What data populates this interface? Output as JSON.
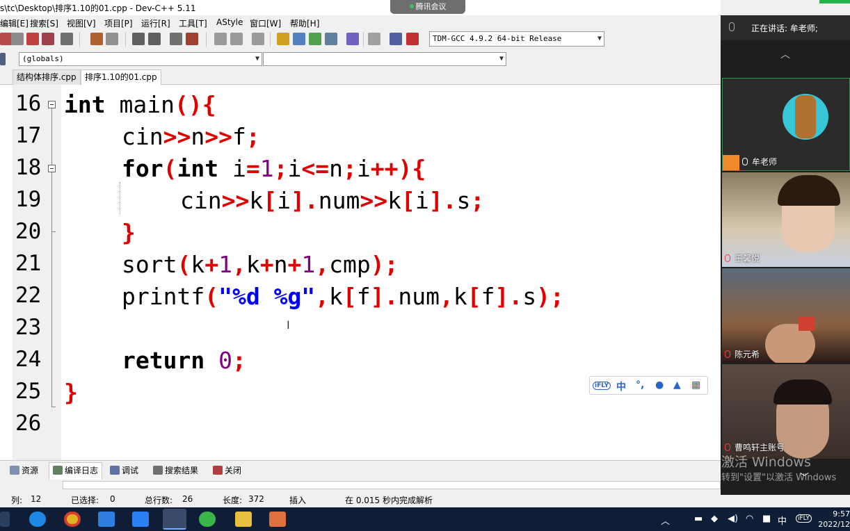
{
  "window": {
    "title": "s\\tc\\Desktop\\排序1.10的01.cpp - Dev-C++ 5.11",
    "meeting_pill": "腾讯会议"
  },
  "menu": [
    "编辑[E]",
    "搜索[S]",
    "视图[V]",
    "项目[P]",
    "运行[R]",
    "工具[T]",
    "AStyle",
    "窗口[W]",
    "帮助[H]"
  ],
  "toolbar": {
    "compiler": "TDM-GCC 4.9.2 64-bit Release"
  },
  "globals": {
    "scope": "(globals)",
    "symbol": ""
  },
  "tabs": [
    {
      "label": "结构体排序.cpp",
      "active": false
    },
    {
      "label": "排序1.10的01.cpp",
      "active": true
    }
  ],
  "editor": {
    "line_numbers": [
      "16",
      "17",
      "18",
      "19",
      "20",
      "21",
      "22",
      "23",
      "24",
      "25",
      "26"
    ],
    "code": {
      "l16a": "int",
      "l16b": " main",
      "l16c": "(){",
      "l17a": "cin",
      "l17b": ">>",
      "l17c": "n",
      "l17d": ">>",
      "l17e": "f",
      "l17f": ";",
      "l18a": "for",
      "l18b": "(",
      "l18c": "int",
      "l18d": " i",
      "l18e": "=",
      "l18f": "1",
      "l18g": ";",
      "l18h": "i",
      "l18i": "<=",
      "l18j": "n",
      "l18k": ";",
      "l18l": "i",
      "l18m": "++){",
      "l19a": "cin",
      "l19b": ">>",
      "l19c": "k",
      "l19d": "[",
      "l19e": "i",
      "l19f": "].",
      "l19g": "num",
      "l19h": ">>",
      "l19i": "k",
      "l19j": "[",
      "l19k": "i",
      "l19l": "].",
      "l19m": "s",
      "l19n": ";",
      "l20a": "}",
      "l21a": "sort",
      "l21b": "(",
      "l21c": "k",
      "l21d": "+",
      "l21e": "1",
      "l21f": ",",
      "l21g": "k",
      "l21h": "+",
      "l21i": "n",
      "l21j": "+",
      "l21k": "1",
      "l21l": ",",
      "l21m": "cmp",
      "l21n": ");",
      "l22a": "printf",
      "l22b": "(",
      "l22c": "\"%d %g\"",
      "l22d": ",",
      "l22e": "k",
      "l22f": "[",
      "l22g": "f",
      "l22h": "].",
      "l22i": "num",
      "l22j": ",",
      "l22k": "k",
      "l22l": "[",
      "l22m": "f",
      "l22n": "].",
      "l22o": "s",
      "l22p": ");",
      "l24a": "return",
      "l24b": " ",
      "l24c": "0",
      "l24d": ";",
      "l25a": "}"
    }
  },
  "ime": {
    "brand": "iFLY",
    "lang": "中"
  },
  "bottom_tabs": [
    "资源",
    "编译日志",
    "调试",
    "搜索结果",
    "关闭"
  ],
  "status": {
    "col_label": "列:",
    "col": "12",
    "sel_label": "已选择:",
    "sel": "0",
    "lines_label": "总行数:",
    "lines": "26",
    "len_label": "长度:",
    "len": "372",
    "mode": "插入",
    "parse": "在 0.015 秒内完成解析"
  },
  "meeting": {
    "speaking": "正在讲话: 牟老师;",
    "participants": [
      "牟老师",
      "王馨悦",
      "陈元希",
      "曹鸣轩主账号"
    ]
  },
  "watermark": {
    "line1": "激活 Windows",
    "line2": "转到\"设置\"以激活 Windows"
  },
  "taskbar": {
    "time": "9:57",
    "date": "2022/12",
    "ime_lang": "中"
  }
}
